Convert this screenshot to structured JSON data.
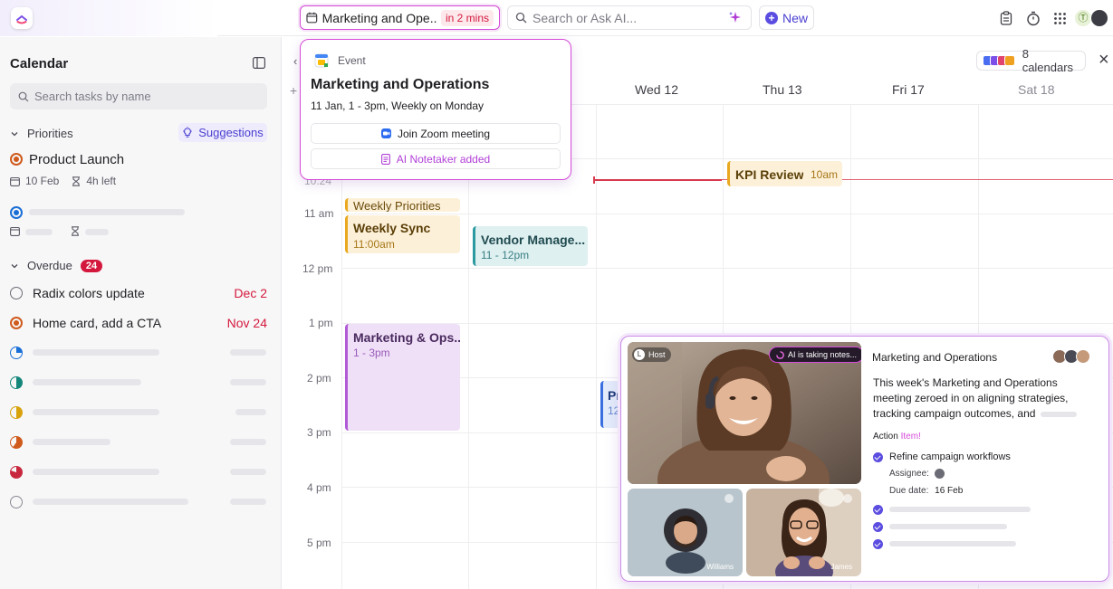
{
  "colors": {
    "accent": "#5b4de0",
    "overdue": "#d4183d",
    "event_highlight": "#d54bd9",
    "priority_orange": "#cf5a1c",
    "priority_blue": "#1a6fd6"
  },
  "topbar": {
    "event_pill": {
      "title": "Marketing and Ope...",
      "badge": "in 2 mins"
    },
    "search": {
      "placeholder": "Search or Ask AI..."
    },
    "new_label": "New",
    "icons": [
      "clipboard-icon",
      "timer-icon",
      "apps-grid-icon"
    ],
    "avatar_initial": "Ⓣ"
  },
  "sidebar": {
    "title": "Calendar",
    "search_placeholder": "Search tasks by name",
    "priorities": {
      "label": "Priorities",
      "suggestions_label": "Suggestions",
      "tasks": [
        {
          "title": "Product Launch",
          "date": "10 Feb",
          "time_left": "4h left"
        }
      ]
    },
    "overdue": {
      "label": "Overdue",
      "count": "24",
      "tasks": [
        {
          "title": "Radix colors update",
          "date": "Dec 2"
        },
        {
          "title": "Home card, add a CTA",
          "date": "Nov 24"
        }
      ]
    }
  },
  "calendar": {
    "calendars_label": "8 calendars",
    "nav_prev": "‹",
    "add": "+",
    "days": [
      {
        "label": "Wed 12",
        "muted": false
      },
      {
        "label": "Thu 13",
        "muted": false
      },
      {
        "label": "Fri 17",
        "muted": false
      },
      {
        "label": "Sat 18",
        "muted": true
      }
    ],
    "hours": [
      "10:24",
      "11 am",
      "12 pm",
      "1 pm",
      "2 pm",
      "3 pm",
      "4 pm",
      "5 pm"
    ],
    "events": [
      {
        "id": "weekly-priorities",
        "title": "Weekly Priorities",
        "time": ""
      },
      {
        "id": "weekly-sync",
        "title": "Weekly Sync",
        "time": "11:00am"
      },
      {
        "id": "vendor",
        "title": "Vendor Manage...",
        "time": "11 - 12pm"
      },
      {
        "id": "kpi",
        "title": "KPI Review",
        "time": "10am"
      },
      {
        "id": "mkt-ops",
        "title": "Marketing & Ops...",
        "time": "1 - 3pm"
      },
      {
        "id": "partial",
        "title": "Pr",
        "time": "12"
      }
    ]
  },
  "popover": {
    "kind": "Event",
    "title": "Marketing and Operations",
    "subtitle": "11 Jan, 1 - 3pm, Weekly on Monday",
    "zoom_label": "Join Zoom meeting",
    "notetaker_label": "AI Notetaker added"
  },
  "ai_card": {
    "host_initial": "L",
    "host_label": "Host",
    "ai_status": "AI is taking notes...",
    "participants": [
      "Williams",
      "James"
    ],
    "title": "Marketing and Operations",
    "summary": "This week's Marketing and Operations meeting zeroed in on aligning strategies, tracking campaign outcomes, and",
    "action_prefix": "Action ",
    "action_highlight": "Item!",
    "action_item": "Refine campaign workflows",
    "assignee_label": "Assignee:",
    "due_label": "Due date:",
    "due_value": "16 Feb"
  }
}
